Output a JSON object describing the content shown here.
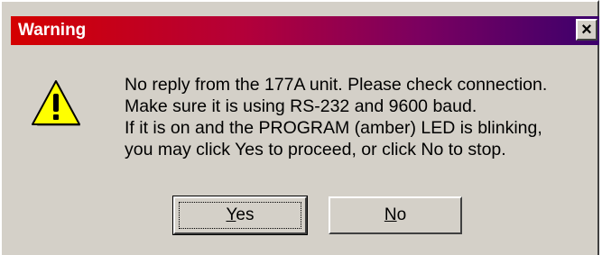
{
  "window": {
    "title": "Warning",
    "close_label": "×"
  },
  "icon": "warning-triangle-icon",
  "message": {
    "lines": [
      "No reply from the 177A unit. Please check connection.",
      "Make sure it is using RS-232 and 9600 baud.",
      "If it is on and the PROGRAM (amber) LED is blinking,",
      "you may click Yes to proceed, or click No to stop."
    ]
  },
  "buttons": {
    "yes": {
      "accel": "Y",
      "rest": "es"
    },
    "no": {
      "accel": "N",
      "rest": "o"
    }
  },
  "colors": {
    "titlebar_start": "#d40000",
    "titlebar_end": "#3c006c",
    "face": "#d4d0c8",
    "icon_fill": "#ffff00"
  }
}
